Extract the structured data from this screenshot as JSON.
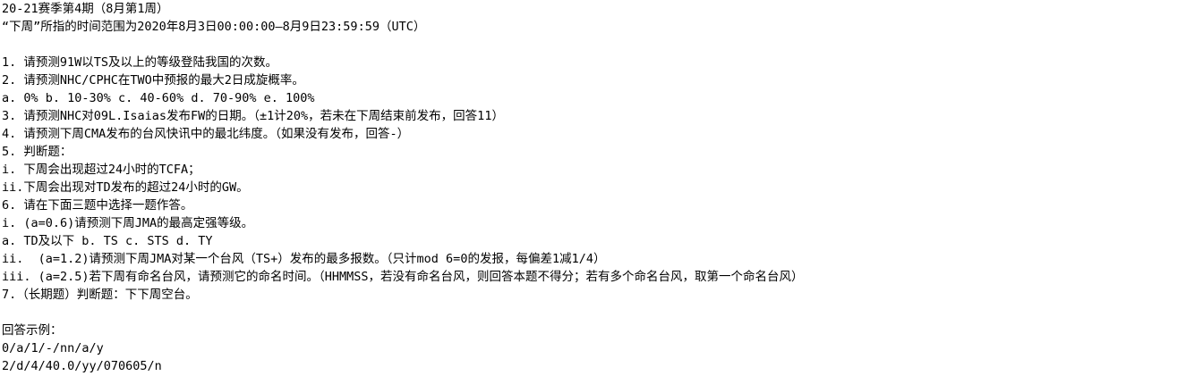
{
  "header": {
    "title": "20-21赛季第4期（8月第1周）",
    "time_range": "“下周”所指的时间范围为2020年8月3日00:00:00—8月9日23:59:59（UTC）"
  },
  "questions": [
    "1. 请预测91W以TS及以上的等级登陆我国的次数。",
    "2. 请预测NHC/CPHC在TWO中预报的最大2日成旋概率。",
    "a. 0% b. 10-30% c. 40-60% d. 70-90% e. 100%",
    "3. 请预测NHC对09L.Isaias发布FW的日期。（±1计20%，若未在下周结束前发布，回答11）",
    "4. 请预测下周CMA发布的台风快讯中的最北纬度。（如果没有发布，回答-）",
    "5. 判断题：",
    "i. 下周会出现超过24小时的TCFA；",
    "ii.下周会出现对TD发布的超过24小时的GW。",
    "6. 请在下面三题中选择一题作答。",
    "i. (a=0.6)请预测下周JMA的最高定强等级。",
    "a. TD及以下 b. TS c. STS d. TY",
    "ii.  (a=1.2)请预测下周JMA对某一个台风（TS+）发布的最多报数。（只计mod 6=0的发报，每偏差1减1/4）",
    "iii. (a=2.5)若下周有命名台风，请预测它的命名时间。（HHMMSS，若没有命名台风，则回答本题不得分；若有多个命名台风，取第一个命名台风）",
    "7.（长期题）判断题：下下周空台。"
  ],
  "answer_example": {
    "heading": "回答示例：",
    "examples": [
      "0/a/1/-/nn/a/y",
      "2/d/4/40.0/yy/070605/n"
    ]
  }
}
